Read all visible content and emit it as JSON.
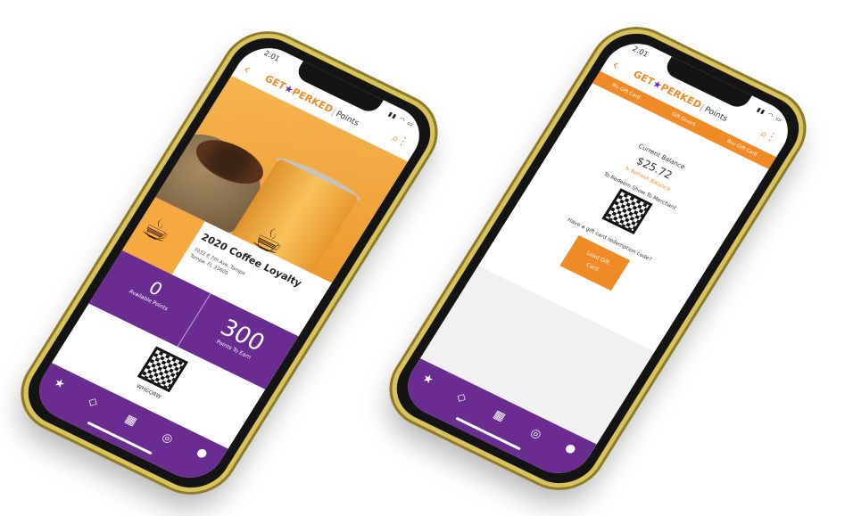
{
  "brand": {
    "logo_left": "GET",
    "logo_star": "★",
    "logo_right": "PERKED",
    "logo_points": "Points",
    "accent": "#f08a24",
    "purple": "#6b2c91"
  },
  "left_phone": {
    "status_time": "2:01",
    "merchant": {
      "name": "2020 Coffee Loyalty",
      "address_line1": "7032 E 7th Ave, Tampa",
      "address_line2": "Tampa, FL 33605"
    },
    "points": {
      "available_value": "0",
      "available_label": "Available Points",
      "to_earn_value": "300",
      "to_earn_label": "Points To Earn"
    },
    "qr_code_text": "WHGQRW",
    "nav_icons": [
      "star-icon",
      "tag-icon",
      "qr-scan-icon",
      "compass-icon",
      "user-icon"
    ]
  },
  "right_phone": {
    "status_time": "2:01",
    "tabs": [
      "My Gift Card",
      "Gift Givers",
      "Buy Gift Card"
    ],
    "current_balance_label": "Current Balance",
    "balance_value": "$25.72",
    "refresh_label": "Refresh Balance",
    "redeem_label": "To Redeem Show To Merchant",
    "redemption_question": "Have a gift card redemption code?",
    "load_button_line1": "Load Gift",
    "load_button_line2": "Card"
  }
}
